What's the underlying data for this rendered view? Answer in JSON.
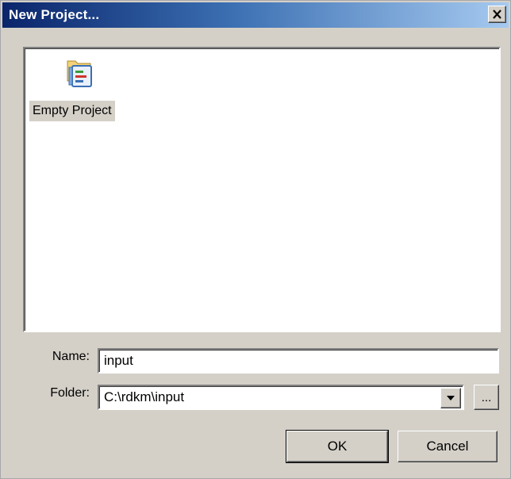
{
  "window": {
    "title": "New Project...",
    "close_icon": "close-icon"
  },
  "project_types": [
    {
      "label": "Empty Project",
      "icon": "empty-project-icon",
      "selected": true
    }
  ],
  "form": {
    "name_label": "Name:",
    "name_value": "input",
    "folder_label": "Folder:",
    "folder_value": "C:\\rdkm\\input",
    "browse_label": "..."
  },
  "buttons": {
    "ok_label": "OK",
    "cancel_label": "Cancel"
  },
  "colors": {
    "face": "#d4d0c8",
    "title_start": "#0a246a",
    "title_end": "#a6caf0"
  }
}
